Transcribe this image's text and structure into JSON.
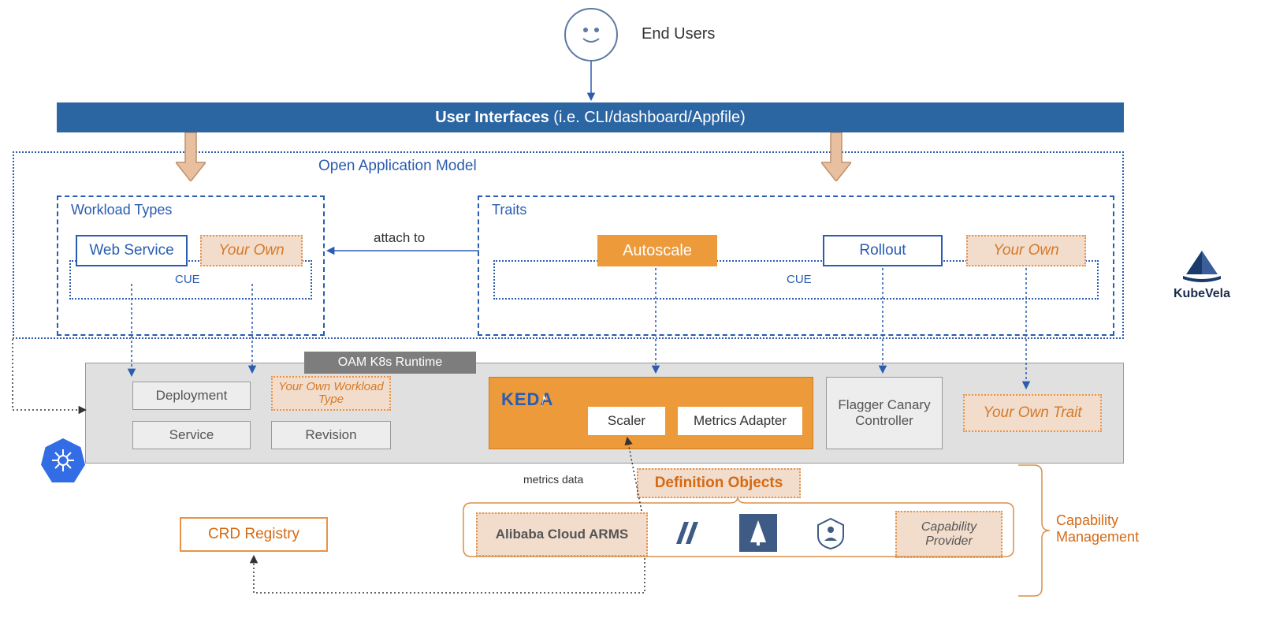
{
  "endUsers": "End Users",
  "uiBar": {
    "bold": "User Interfaces",
    "rest": " (i.e. CLI/dashboard/Appfile)"
  },
  "oamLabel": "Open Application Model",
  "workloadTypes": {
    "title": "Workload Types",
    "web": "Web Service",
    "own": "Your Own",
    "cue": "CUE"
  },
  "traits": {
    "title": "Traits",
    "autoscale": "Autoscale",
    "rollout": "Rollout",
    "own": "Your Own",
    "cue": "CUE"
  },
  "attachTo": "attach to",
  "runtime": {
    "tab": "OAM K8s Runtime",
    "deployment": "Deployment",
    "service": "Service",
    "ownWorkload": "Your Own Workload Type",
    "revision": "Revision",
    "keda": "KEDA",
    "scaler": "Scaler",
    "metricsAdapter": "Metrics Adapter",
    "flagger": "Flagger Canary Controller",
    "ownTrait": "Your Own Trait"
  },
  "metricsData": "metrics data",
  "defObjects": "Definition Objects",
  "arms": "Alibaba Cloud ARMS",
  "capProvider": "Capability Provider",
  "crd": "CRD Registry",
  "capMgmt": "Capability Management",
  "kubevela": "KubeVela"
}
